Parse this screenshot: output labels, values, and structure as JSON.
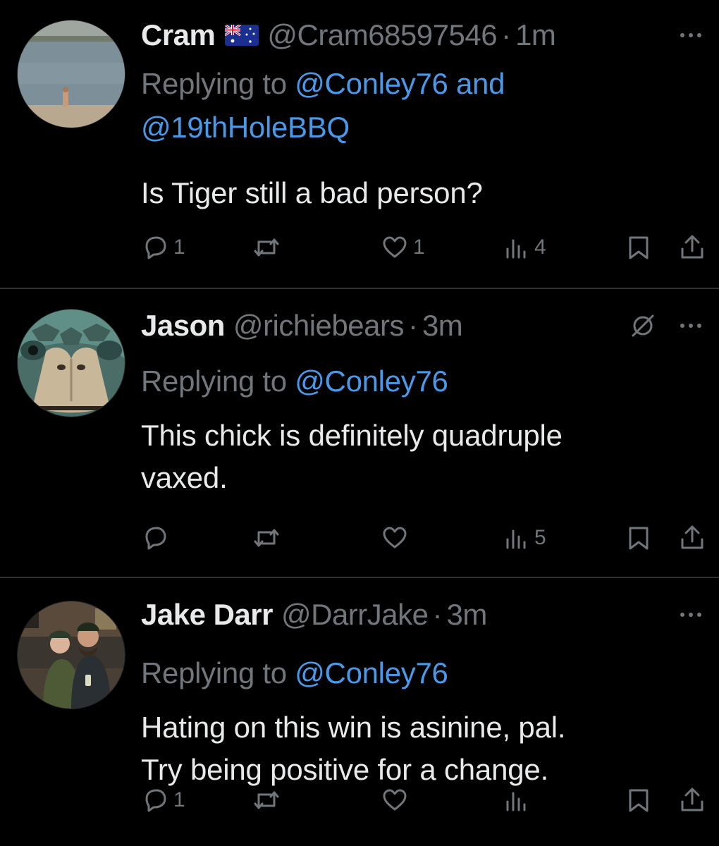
{
  "tweets": [
    {
      "name": "Cram",
      "has_flag": true,
      "flag_country": "Australia",
      "handle": "@Cram68597546",
      "separator": "·",
      "time": "1m",
      "muted": false,
      "replying_prefix": "Replying to ",
      "replying_mention_1": "@Conley76 and",
      "replying_mention_2": "@19thHoleBBQ",
      "text_lines": [
        "Is Tiger still a bad person?"
      ],
      "reply_count": "1",
      "retweet_count": "",
      "like_count": "1",
      "view_count": "4"
    },
    {
      "name": "Jason",
      "has_flag": false,
      "handle": "@richiebears",
      "separator": "·",
      "time": "3m",
      "muted": true,
      "replying_prefix": "Replying to ",
      "replying_mention_1": "@Conley76",
      "text_lines": [
        "This chick is definitely quadruple",
        "vaxed."
      ],
      "reply_count": "",
      "retweet_count": "",
      "like_count": "",
      "view_count": "5"
    },
    {
      "name": "Jake Darr",
      "has_flag": false,
      "handle": "@DarrJake",
      "separator": "·",
      "time": "3m",
      "muted": false,
      "replying_prefix": "Replying to ",
      "replying_mention_1": "@Conley76",
      "text_lines": [
        "Hating on this win is asinine, pal.",
        "Try being positive for a change."
      ],
      "reply_count": "1",
      "retweet_count": "",
      "like_count": "",
      "view_count": ""
    }
  ],
  "colors": {
    "background": "#000000",
    "text_primary": "#e7e9ea",
    "text_secondary": "#71767b",
    "mention": "#4a99e9",
    "divider": "#2f3336"
  },
  "icons": {
    "reply": "reply-icon",
    "retweet": "retweet-icon",
    "like": "heart-icon",
    "views": "views-icon",
    "bookmark": "bookmark-icon",
    "share": "share-icon",
    "more": "more-icon",
    "muted": "muted-icon"
  }
}
